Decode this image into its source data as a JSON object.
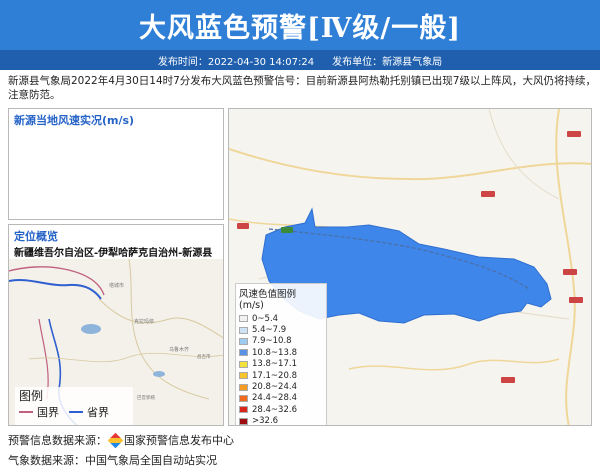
{
  "header": {
    "title": "大风蓝色预警[Ⅳ级/一般]",
    "publish_time": "发布时间：2022-04-30 14:07:24",
    "publisher": "发布单位：新源县气象局"
  },
  "description": "新源县气象局2022年4月30日14时7分发布大风蓝色预警信号：目前新源县阿热勒托别镇已出现7级以上阵风，大风仍将持续，注意防范。",
  "wind_panel": {
    "title": "新源当地风速实况(m/s)"
  },
  "location_panel": {
    "title": "定位概览",
    "region": "新疆维吾尔自治区-伊犁哈萨克自治州-新源县",
    "legend": {
      "title": "图例",
      "items": [
        "国界",
        "省界"
      ]
    },
    "colors": {
      "national": "#c06080",
      "provincial": "#2f5fd0"
    }
  },
  "wind_legend": {
    "title": "风速色值图例 (m/s)",
    "items": [
      {
        "label": "0~5.4",
        "color": "#f2f2f2"
      },
      {
        "label": "5.4~7.9",
        "color": "#cfe3f7"
      },
      {
        "label": "7.9~10.8",
        "color": "#9ecbf0"
      },
      {
        "label": "10.8~13.8",
        "color": "#5a93e6"
      },
      {
        "label": "13.8~17.1",
        "color": "#f4e13a"
      },
      {
        "label": "17.1~20.8",
        "color": "#f7c42b"
      },
      {
        "label": "20.8~24.4",
        "color": "#f59a22"
      },
      {
        "label": "24.4~28.4",
        "color": "#ef6a1d"
      },
      {
        "label": "28.4~32.6",
        "color": "#d9261c"
      },
      {
        "label": ">32.6",
        "color": "#9e0d10"
      }
    ]
  },
  "footer": {
    "warning_source_label": "预警信息数据来源：",
    "warning_source": "国家预警信息发布中心",
    "weather_source": "气象数据来源：中国气象局全国自动站实况"
  },
  "colors": {
    "header_bg": "#2f7fd6",
    "subbar_bg": "#1f5fae",
    "warning_area": "#3f86ea"
  }
}
